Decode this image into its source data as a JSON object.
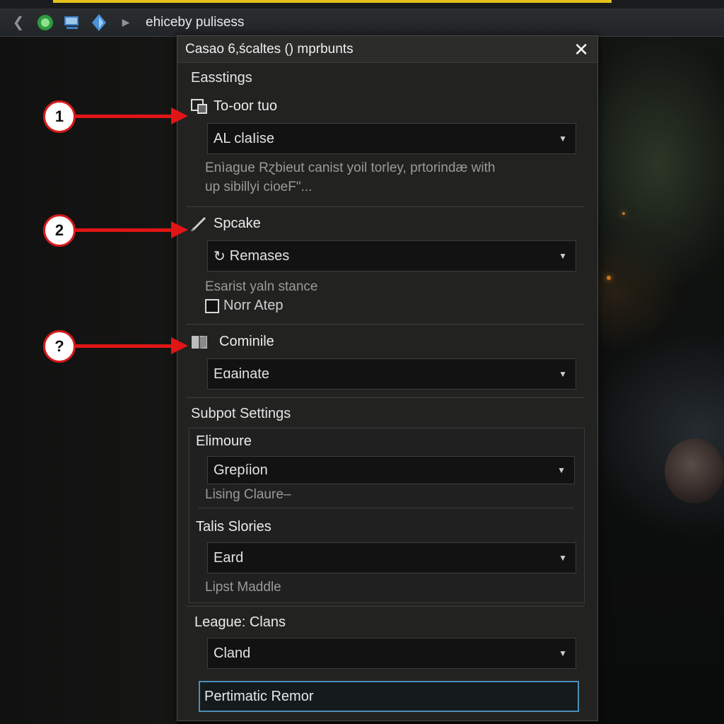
{
  "navbar": {
    "title": "ehiceby pulisess"
  },
  "dialog": {
    "title": "Casao 6,ścaltes () mprbunts",
    "section1_title": "Easstings",
    "item1": {
      "label": "To-oor tuo",
      "dropdown_value": "AL claIise",
      "description_line1": "Enìague Rɀbieut canist yoil torley, prtorindæ with",
      "description_line2": "up sibillyi cioeF\"..."
    },
    "item2": {
      "label": "Spcake",
      "dropdown_value": "Remases",
      "description": "Esarist yaln stance",
      "checkbox_label": "Norr Atep"
    },
    "item3": {
      "label": "Cominile",
      "dropdown_value": "Eɑainate"
    },
    "section2_title": "Subpot Settings",
    "sub1": {
      "label": "Elimoure",
      "dropdown_value": "Grepíion",
      "description": "Lising Claure–"
    },
    "sub2": {
      "label": "Talis Slories",
      "dropdown_value": "Eard",
      "description": "Lipst Maddle"
    },
    "league": {
      "label": "League: Clans",
      "dropdown_value": "Cland",
      "input_value": "Pertimatic Remor"
    }
  },
  "callouts": {
    "c1": "1",
    "c2": "2",
    "c3": "?"
  },
  "colors": {
    "callout_red": "#e01515",
    "input_border": "#4a8fb8",
    "top_accent": "#e5c21c"
  }
}
